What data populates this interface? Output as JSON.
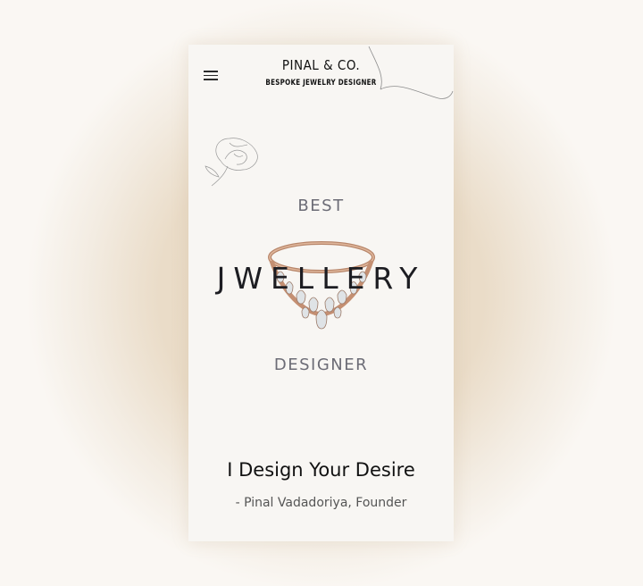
{
  "header": {
    "brand_name": "PINAL & CO.",
    "brand_tagline": "BESPOKE JEWELRY DESIGNER",
    "menu_icon": "hamburger-menu-icon"
  },
  "hero": {
    "line1": "BEST",
    "line2": "JWELLERY",
    "line3": "DESIGNER"
  },
  "quote": {
    "text": "I Design Your Desire",
    "author": "- Pinal Vadadoriya, Founder"
  },
  "colors": {
    "background_glow": "#e6d6c0",
    "page_background": "#f8f6f3",
    "heading_dark": "#1d1d22",
    "heading_grey": "#6c6c76"
  }
}
